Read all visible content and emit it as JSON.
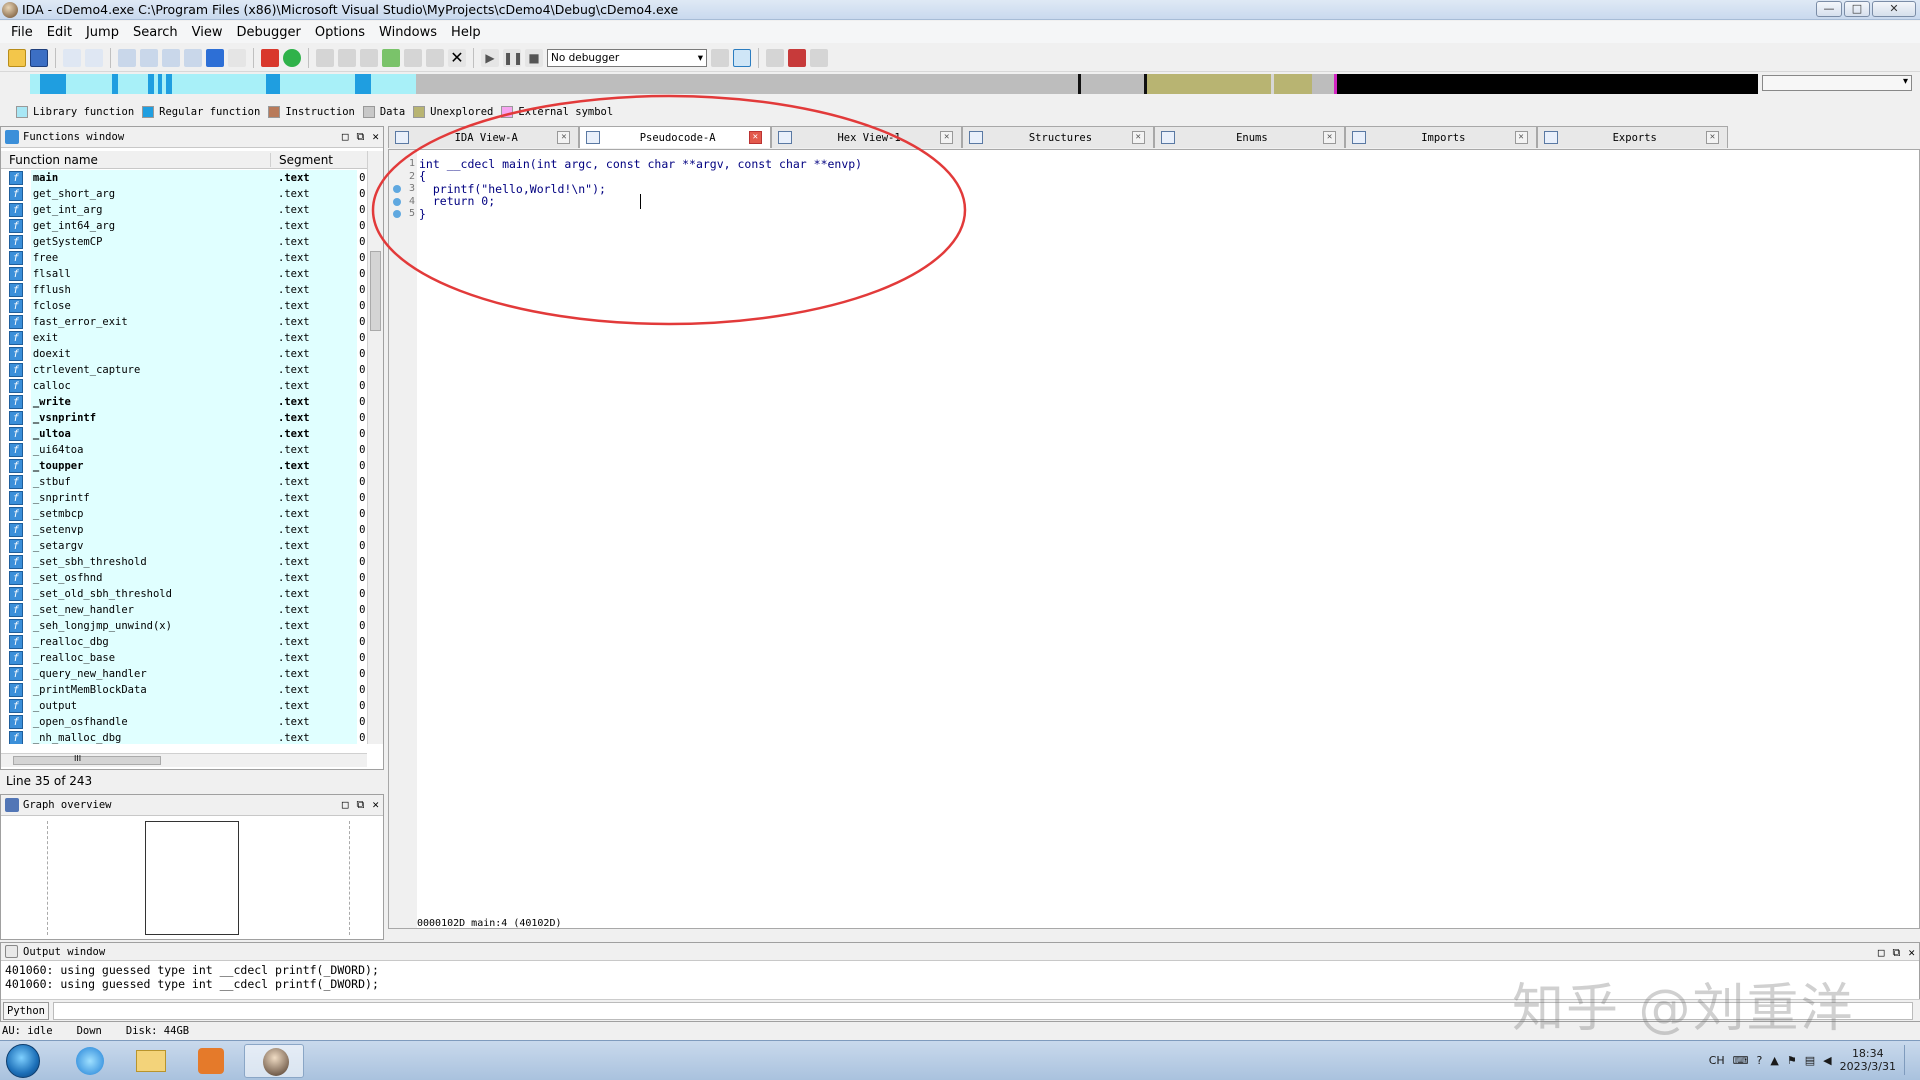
{
  "window": {
    "title": "IDA - cDemo4.exe C:\\Program Files (x86)\\Microsoft Visual Studio\\MyProjects\\cDemo4\\Debug\\cDemo4.exe",
    "min": "—",
    "max": "□",
    "close": "✕"
  },
  "menu": [
    "File",
    "Edit",
    "Jump",
    "Search",
    "View",
    "Debugger",
    "Options",
    "Windows",
    "Help"
  ],
  "toolbar": {
    "debugger_select": "No debugger"
  },
  "legend": [
    {
      "label": "Library function",
      "color": "#a8e7f5"
    },
    {
      "label": "Regular function",
      "color": "#1f9ee0"
    },
    {
      "label": "Instruction",
      "color": "#b87a5a"
    },
    {
      "label": "Data",
      "color": "#c8c8c8"
    },
    {
      "label": "Unexplored",
      "color": "#b8b472"
    },
    {
      "label": "External symbol",
      "color": "#f6a5f0"
    }
  ],
  "functions_window": {
    "title": "Functions window",
    "col_name": "Function name",
    "col_segment": "Segment",
    "rows": [
      {
        "name": "main",
        "seg": ".text",
        "a": "0",
        "bold": true
      },
      {
        "name": "get_short_arg",
        "seg": ".text",
        "a": "0"
      },
      {
        "name": "get_int_arg",
        "seg": ".text",
        "a": "0"
      },
      {
        "name": "get_int64_arg",
        "seg": ".text",
        "a": "0"
      },
      {
        "name": "getSystemCP",
        "seg": ".text",
        "a": "0"
      },
      {
        "name": "free",
        "seg": ".text",
        "a": "0"
      },
      {
        "name": "flsall",
        "seg": ".text",
        "a": "0"
      },
      {
        "name": "fflush",
        "seg": ".text",
        "a": "0"
      },
      {
        "name": "fclose",
        "seg": ".text",
        "a": "0"
      },
      {
        "name": "fast_error_exit",
        "seg": ".text",
        "a": "0"
      },
      {
        "name": "exit",
        "seg": ".text",
        "a": "0"
      },
      {
        "name": "doexit",
        "seg": ".text",
        "a": "0"
      },
      {
        "name": "ctrlevent_capture",
        "seg": ".text",
        "a": "0"
      },
      {
        "name": "calloc",
        "seg": ".text",
        "a": "0"
      },
      {
        "name": "_write",
        "seg": ".text",
        "a": "0",
        "bold": true
      },
      {
        "name": "_vsnprintf",
        "seg": ".text",
        "a": "0",
        "bold": true
      },
      {
        "name": "_ultoa",
        "seg": ".text",
        "a": "0",
        "bold": true
      },
      {
        "name": "_ui64toa",
        "seg": ".text",
        "a": "0"
      },
      {
        "name": "_toupper",
        "seg": ".text",
        "a": "0",
        "bold": true
      },
      {
        "name": "_stbuf",
        "seg": ".text",
        "a": "0"
      },
      {
        "name": "_snprintf",
        "seg": ".text",
        "a": "0"
      },
      {
        "name": "_setmbcp",
        "seg": ".text",
        "a": "0"
      },
      {
        "name": "_setenvp",
        "seg": ".text",
        "a": "0"
      },
      {
        "name": "_setargv",
        "seg": ".text",
        "a": "0"
      },
      {
        "name": "_set_sbh_threshold",
        "seg": ".text",
        "a": "0"
      },
      {
        "name": "_set_osfhnd",
        "seg": ".text",
        "a": "0"
      },
      {
        "name": "_set_old_sbh_threshold",
        "seg": ".text",
        "a": "0"
      },
      {
        "name": "_set_new_handler",
        "seg": ".text",
        "a": "0"
      },
      {
        "name": "_seh_longjmp_unwind(x)",
        "seg": ".text",
        "a": "0"
      },
      {
        "name": "_realloc_dbg",
        "seg": ".text",
        "a": "0"
      },
      {
        "name": "_realloc_base",
        "seg": ".text",
        "a": "0"
      },
      {
        "name": "_query_new_handler",
        "seg": ".text",
        "a": "0"
      },
      {
        "name": "_printMemBlockData",
        "seg": ".text",
        "a": "0"
      },
      {
        "name": "_output",
        "seg": ".text",
        "a": "0"
      },
      {
        "name": "_open_osfhandle",
        "seg": ".text",
        "a": "0"
      },
      {
        "name": "_nh_malloc_dbg",
        "seg": ".text",
        "a": "0"
      }
    ],
    "line_info": "Line 35 of 243",
    "hscroll_mark": "III"
  },
  "graph_overview": {
    "title": "Graph overview"
  },
  "tabs": [
    {
      "label": "IDA View-A",
      "active": false
    },
    {
      "label": "Pseudocode-A",
      "active": true
    },
    {
      "label": "Hex View-1",
      "active": false
    },
    {
      "label": "Structures",
      "active": false
    },
    {
      "label": "Enums",
      "active": false
    },
    {
      "label": "Imports",
      "active": false
    },
    {
      "label": "Exports",
      "active": false
    }
  ],
  "code": {
    "lines": [
      {
        "n": "1",
        "text": "int __cdecl main(int argc, const char **argv, const char **envp)",
        "dot": false
      },
      {
        "n": "2",
        "text": "{",
        "dot": false
      },
      {
        "n": "3",
        "text": "  printf(\"hello,World!\\n\");",
        "dot": true
      },
      {
        "n": "4",
        "text": "  return 0;",
        "dot": true
      },
      {
        "n": "5",
        "text": "}",
        "dot": true
      }
    ],
    "status": "0000102D main:4 (40102D)"
  },
  "output_window": {
    "title": "Output window",
    "lines": [
      "401060: using guessed type int __cdecl printf(_DWORD);",
      "401060: using guessed type int __cdecl printf(_DWORD);"
    ],
    "python_btn": "Python"
  },
  "statusbar": {
    "au": "AU:  idle",
    "dir": "Down",
    "disk": "Disk: 44GB"
  },
  "watermark": "知乎 @刘重洋",
  "taskbar": {
    "lang": "CH",
    "time": "18:34",
    "date": "2023/3/31"
  }
}
